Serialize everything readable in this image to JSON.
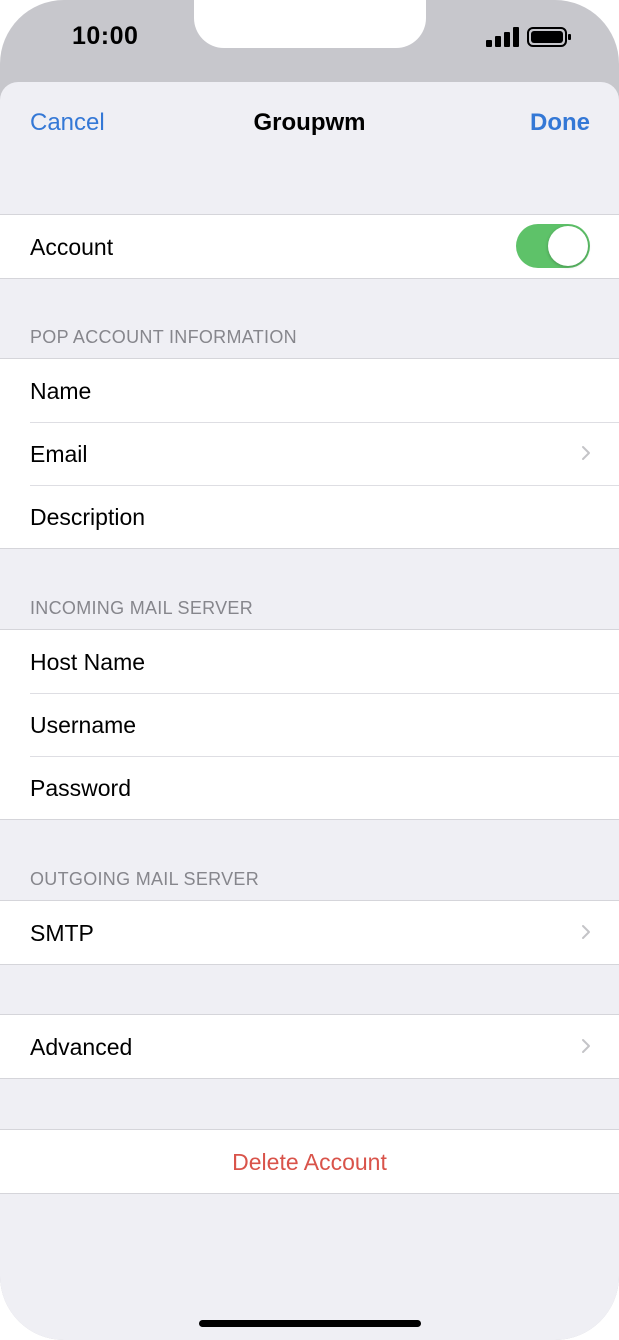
{
  "status_bar": {
    "time": "10:00"
  },
  "nav": {
    "cancel_label": "Cancel",
    "title": "Groupwm",
    "done_label": "Done"
  },
  "account": {
    "label": "Account",
    "enabled": true
  },
  "pop_section": {
    "header": "POP ACCOUNT INFORMATION",
    "rows": [
      {
        "label": "Name"
      },
      {
        "label": "Email",
        "chevron": true
      },
      {
        "label": "Description"
      }
    ]
  },
  "incoming_section": {
    "header": "INCOMING MAIL SERVER",
    "rows": [
      {
        "label": "Host Name"
      },
      {
        "label": "Username"
      },
      {
        "label": "Password"
      }
    ]
  },
  "outgoing_section": {
    "header": "OUTGOING MAIL SERVER",
    "rows": [
      {
        "label": "SMTP",
        "chevron": true
      }
    ]
  },
  "advanced": {
    "label": "Advanced"
  },
  "delete": {
    "label": "Delete Account"
  },
  "colors": {
    "accent": "#3478d6",
    "toggle_on": "#5ec269",
    "destructive": "#d9534a",
    "background": "#efeff4"
  }
}
